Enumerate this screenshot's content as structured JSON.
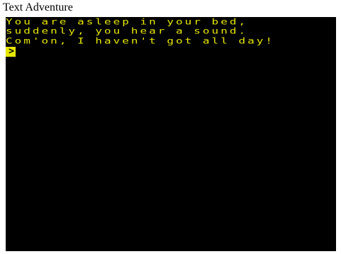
{
  "window": {
    "title": "Text Adventure"
  },
  "screen": {
    "lines": [
      "You are asleep in your bed,",
      "suddenly, you hear a sound.",
      "Com'on, I haven't got all day!"
    ],
    "prompt": ">",
    "colors": {
      "background": "#000000",
      "text": "#e6e600"
    }
  }
}
